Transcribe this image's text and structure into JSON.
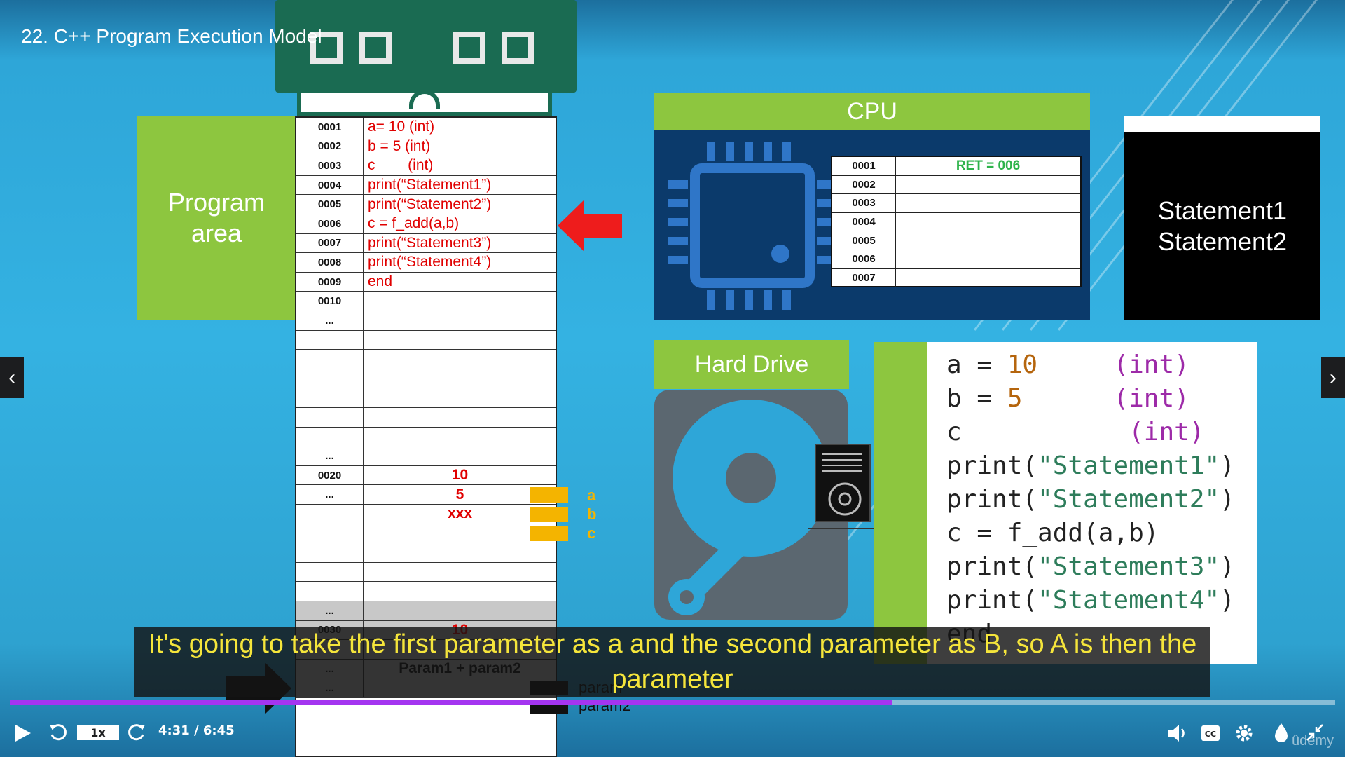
{
  "lesson": {
    "title": "22. C++ Program Execution Model"
  },
  "program_area": {
    "line1": "Program",
    "line2": "area"
  },
  "memory": {
    "rows": [
      {
        "addr": "0001",
        "value": "a= 10 (int)"
      },
      {
        "addr": "0002",
        "value": "b = 5 (int)"
      },
      {
        "addr": "0003",
        "value": "c        (int)"
      },
      {
        "addr": "0004",
        "value": "print(“Statement1”)"
      },
      {
        "addr": "0005",
        "value": "print(“Statement2”)"
      },
      {
        "addr": "0006",
        "value": "c = f_add(a,b)"
      },
      {
        "addr": "0007",
        "value": "print(“Statement3”)"
      },
      {
        "addr": "0008",
        "value": "print(“Statement4”)"
      },
      {
        "addr": "0009",
        "value": "end"
      },
      {
        "addr": "0010",
        "value": ""
      },
      {
        "addr": "...",
        "value": ""
      }
    ],
    "data_rows": [
      {
        "addr": "...",
        "value": ""
      },
      {
        "addr": "0020",
        "value": "10"
      },
      {
        "addr": "...",
        "value": "5"
      },
      {
        "addr": "",
        "value": "xxx"
      }
    ],
    "stack_rows": [
      {
        "addr": "...",
        "value": ""
      },
      {
        "addr": "0030",
        "value": "10"
      },
      {
        "addr": "",
        "value": ""
      },
      {
        "addr": "...",
        "value": "Param1 + param2"
      },
      {
        "addr": "...",
        "value": ""
      }
    ],
    "var_labels": [
      "a",
      "b",
      "c"
    ],
    "param_labels": [
      "param",
      "param2"
    ]
  },
  "cpu": {
    "title": "CPU",
    "registers": [
      {
        "addr": "0001",
        "value": "RET = 006"
      },
      {
        "addr": "0002",
        "value": ""
      },
      {
        "addr": "0003",
        "value": ""
      },
      {
        "addr": "0004",
        "value": ""
      },
      {
        "addr": "0005",
        "value": ""
      },
      {
        "addr": "0006",
        "value": ""
      },
      {
        "addr": "0007",
        "value": ""
      }
    ]
  },
  "output": {
    "line1": "Statement1",
    "line2": "Statement2"
  },
  "hard_drive": {
    "title": "Hard Drive"
  },
  "code": {
    "lines": [
      {
        "parts": [
          [
            "plain",
            "a = "
          ],
          [
            "num",
            "10"
          ],
          [
            "plain",
            "     "
          ],
          [
            "kw",
            "(int)"
          ]
        ]
      },
      {
        "parts": [
          [
            "plain",
            "b = "
          ],
          [
            "num",
            "5"
          ],
          [
            "plain",
            "      "
          ],
          [
            "kw",
            "(int)"
          ]
        ]
      },
      {
        "parts": [
          [
            "plain",
            "c"
          ],
          [
            "plain",
            "           "
          ],
          [
            "kw",
            "(int)"
          ]
        ]
      },
      {
        "parts": [
          [
            "plain",
            "print("
          ],
          [
            "str",
            "\"Statement1\""
          ],
          [
            "plain",
            ")"
          ]
        ]
      },
      {
        "parts": [
          [
            "plain",
            "print("
          ],
          [
            "str",
            "\"Statement2\""
          ],
          [
            "plain",
            ")"
          ]
        ]
      },
      {
        "parts": [
          [
            "plain",
            "c = f_add(a,b)"
          ]
        ]
      },
      {
        "parts": [
          [
            "plain",
            "print("
          ],
          [
            "str",
            "\"Statement3\""
          ],
          [
            "plain",
            ")"
          ]
        ]
      },
      {
        "parts": [
          [
            "plain",
            "print("
          ],
          [
            "str",
            "\"Statement4\""
          ],
          [
            "plain",
            ")"
          ]
        ]
      },
      {
        "parts": [
          [
            "plain",
            "end"
          ]
        ]
      }
    ]
  },
  "subtitle": {
    "text": "It's going to take the first parameter as a and the second parameter as B, so A is then the parameter"
  },
  "player": {
    "rate": "1x",
    "time": "4:31 / 6:45",
    "progress": 0.666,
    "prev_label": "‹",
    "next_label": "›",
    "watermark": "ûdemy"
  },
  "colors": {
    "green": "#8dc63f",
    "cpu_blue": "#0b3a6b",
    "chip_green": "#1a6b52",
    "accent_red": "#e00000",
    "progress": "#a435f0",
    "subtitle": "#f5e53b"
  }
}
